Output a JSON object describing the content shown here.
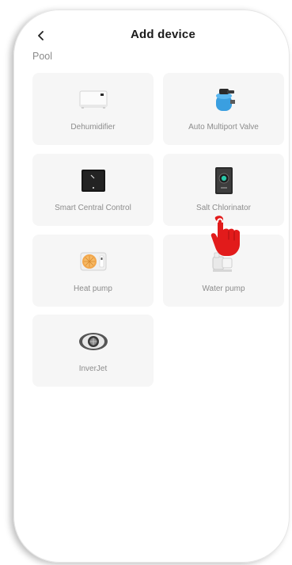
{
  "header": {
    "title": "Add device",
    "back_icon": "chevron-left-icon"
  },
  "section": {
    "label": "Pool"
  },
  "devices": [
    {
      "label": "Dehumidifier",
      "icon": "dehumidifier-icon"
    },
    {
      "label": "Auto Multiport Valve",
      "icon": "multiport-valve-icon"
    },
    {
      "label": "Smart Central Control",
      "icon": "central-control-icon"
    },
    {
      "label": "Salt Chlorinator",
      "icon": "salt-chlorinator-icon"
    },
    {
      "label": "Heat pump",
      "icon": "heat-pump-icon"
    },
    {
      "label": "Water pump",
      "icon": "water-pump-icon"
    },
    {
      "label": "InverJet",
      "icon": "inverjet-icon"
    }
  ],
  "overlay": {
    "icon": "tap-hand-icon",
    "color": "#e21b1b"
  }
}
